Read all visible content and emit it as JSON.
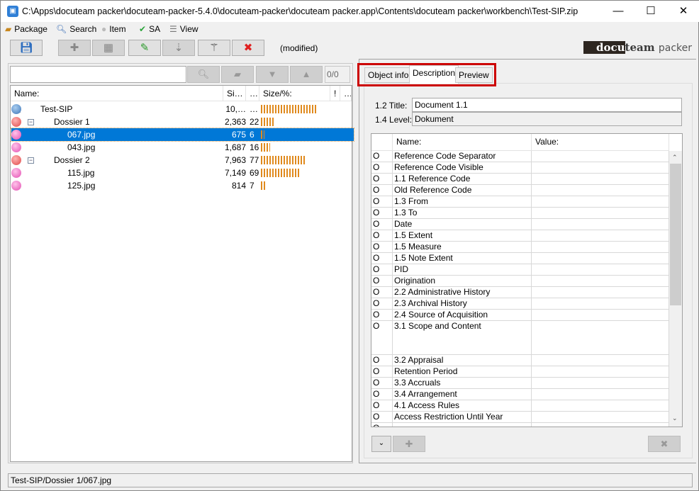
{
  "window": {
    "title": "C:\\Apps\\docuteam packer\\docuteam-packer-5.4.0\\docuteam-packer\\docuteam packer.app\\Contents\\docuteam packer\\workbench\\Test-SIP.zip",
    "minimize": "—",
    "maximize": "☐",
    "close": "✕"
  },
  "menu": [
    {
      "label": "Package",
      "icon": "package-icon"
    },
    {
      "label": "Search",
      "icon": "search-icon"
    },
    {
      "label": "Item",
      "icon": "item-icon"
    },
    {
      "label": "SA",
      "icon": "check-icon"
    },
    {
      "label": "View",
      "icon": "list-icon"
    }
  ],
  "toolbar": {
    "status": "(modified)",
    "buttons": [
      "save",
      "add",
      "group",
      "edit",
      "sort",
      "wand",
      "delete"
    ]
  },
  "logo": {
    "part1": "docu",
    "part2": "team",
    "part3": "packer"
  },
  "search": {
    "value": "",
    "counter": "0/0"
  },
  "tree": {
    "columns": [
      "Name:",
      "Si…",
      "…",
      "Size/%:",
      "!",
      "…"
    ],
    "rows": [
      {
        "name": "Test-SIP",
        "size": "10,…",
        "pct": "…",
        "bar": 100,
        "level": 0,
        "type": "root"
      },
      {
        "name": "Dossier 1",
        "size": "2,363",
        "pct": "22",
        "bar": 22,
        "level": 1,
        "type": "folder"
      },
      {
        "name": "067.jpg",
        "size": "675",
        "pct": "6",
        "bar": 6,
        "level": 2,
        "type": "file",
        "selected": true
      },
      {
        "name": "043.jpg",
        "size": "1,687",
        "pct": "16",
        "bar": 16,
        "level": 2,
        "type": "file"
      },
      {
        "name": "Dossier 2",
        "size": "7,963",
        "pct": "77",
        "bar": 77,
        "level": 1,
        "type": "folder"
      },
      {
        "name": "115.jpg",
        "size": "7,149",
        "pct": "69",
        "bar": 69,
        "level": 2,
        "type": "file"
      },
      {
        "name": "125.jpg",
        "size": "814",
        "pct": "7",
        "bar": 7,
        "level": 2,
        "type": "file"
      }
    ]
  },
  "tabs": [
    "Object info",
    "Description",
    "Preview"
  ],
  "active_tab": "Description",
  "description": {
    "title_label": "1.2 Title:",
    "title_value": "Document 1.1",
    "level_label": "1.4 Level:",
    "level_value": "Dokument",
    "columns": [
      "Name:",
      "Value:"
    ],
    "rows": [
      "Reference Code Separator",
      "Reference Code Visible",
      "1.1 Reference Code",
      "Old Reference Code",
      "1.3 From",
      "1.3 To",
      "Date",
      "1.5 Extent",
      "1.5 Measure",
      "1.5 Note Extent",
      "PID",
      "Origination",
      "2.2 Administrative History",
      "2.3 Archival History",
      "2.4 Source of Acquisition",
      "3.1 Scope and Content",
      "3.2 Appraisal",
      "Retention Period",
      "3.3 Accruals",
      "3.4 Arrangement",
      "4.1 Access Rules",
      "Access Restriction Until Year",
      ""
    ],
    "flag": "O"
  },
  "statusbar": {
    "path": "Test-SIP/Dossier 1/067.jpg"
  },
  "colors": {
    "selection": "#0078d7",
    "bar": "#e08a1e",
    "highlight": "#cc0000"
  }
}
